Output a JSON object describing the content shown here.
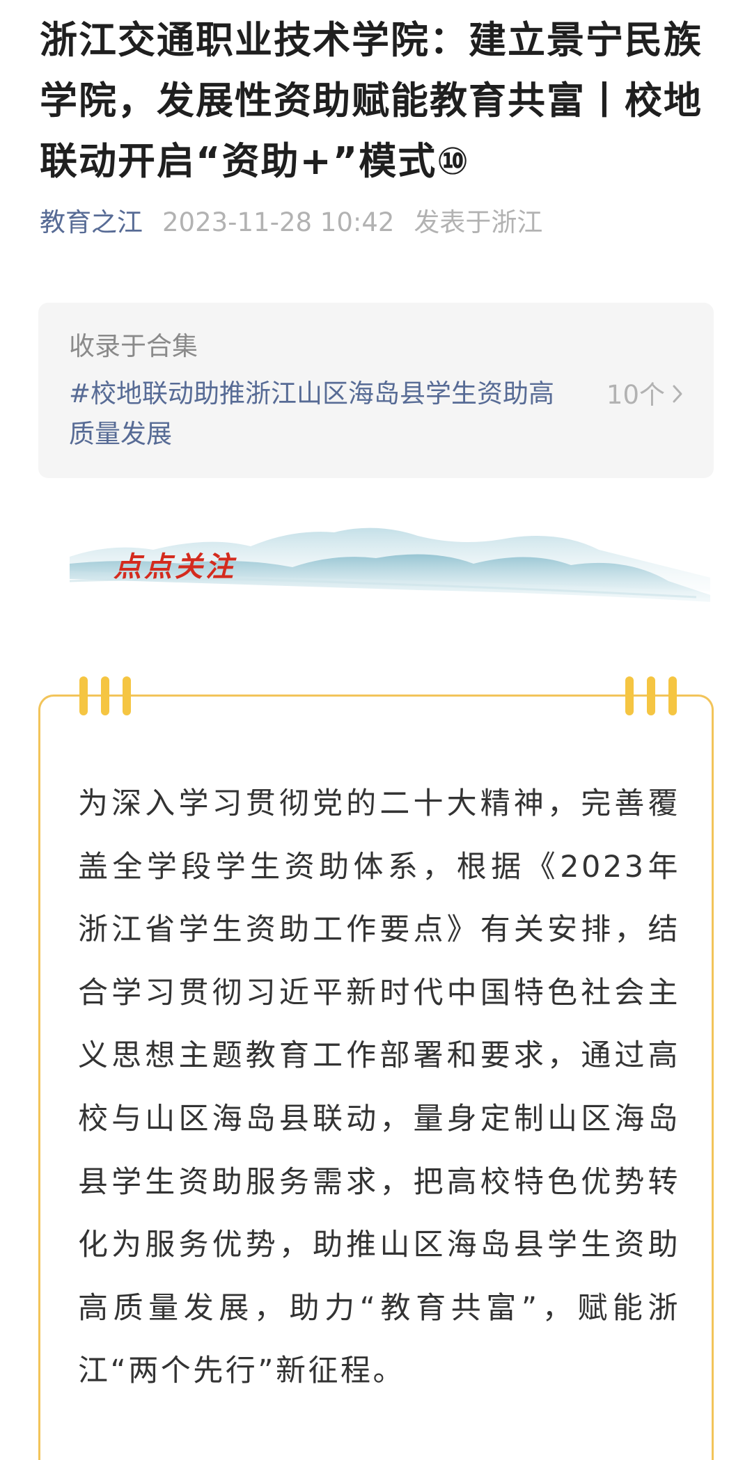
{
  "article": {
    "title": "浙江交通职业技术学院：建立景宁民族学院，发展性资助赋能教育共富丨校地联动开启“资助+”模式⑩",
    "account": "教育之江",
    "datetime": "2023-11-28 10:42",
    "location": "发表于浙江"
  },
  "collection": {
    "label": "收录于合集",
    "topic": "#校地联动助推浙江山区海岛县学生资助高质量发展",
    "count": "10个",
    "chevron_icon": "chevron-right-icon"
  },
  "banner": {
    "text": "点点关注",
    "text_color": "#d42b1e",
    "decoration": "ink-wash-mountains"
  },
  "intro_card": {
    "border_color": "#f2c45a",
    "accent_color": "#f5c542",
    "body": "为深入学习贯彻党的二十大精神，完善覆盖全学段学生资助体系，根据《2023年浙江省学生资助工作要点》有关安排，结合学习贯彻习近平新时代中国特色社会主义思想主题教育工作部署和要求，通过高校与山区海岛县联动，量身定制山区海岛县学生资助服务需求，把高校特色优势转化为服务优势，助推山区海岛县学生资助高质量发展，助力“教育共富”，赋能浙江“两个先行”新征程。"
  },
  "colors": {
    "link": "#576b95",
    "muted": "#b2b2b2",
    "collection_bg": "#f5f5f5"
  }
}
